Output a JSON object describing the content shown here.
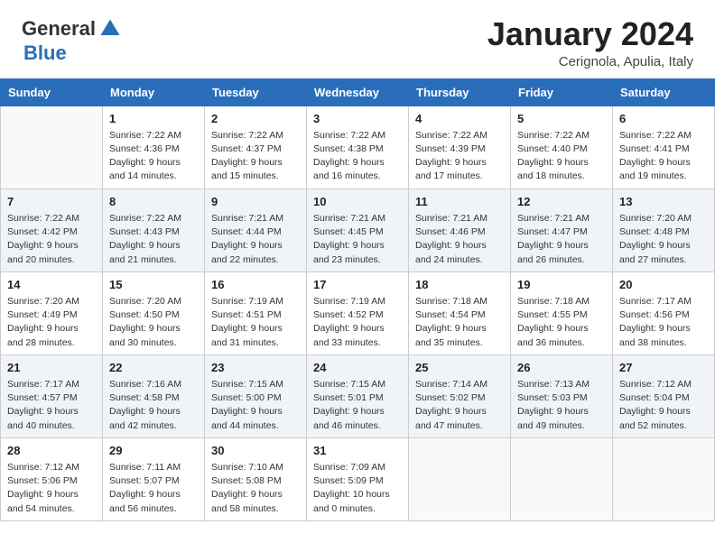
{
  "header": {
    "logo_general": "General",
    "logo_blue": "Blue",
    "month": "January 2024",
    "location": "Cerignola, Apulia, Italy"
  },
  "columns": [
    "Sunday",
    "Monday",
    "Tuesday",
    "Wednesday",
    "Thursday",
    "Friday",
    "Saturday"
  ],
  "weeks": [
    [
      {
        "day": "",
        "info": ""
      },
      {
        "day": "1",
        "info": "Sunrise: 7:22 AM\nSunset: 4:36 PM\nDaylight: 9 hours\nand 14 minutes."
      },
      {
        "day": "2",
        "info": "Sunrise: 7:22 AM\nSunset: 4:37 PM\nDaylight: 9 hours\nand 15 minutes."
      },
      {
        "day": "3",
        "info": "Sunrise: 7:22 AM\nSunset: 4:38 PM\nDaylight: 9 hours\nand 16 minutes."
      },
      {
        "day": "4",
        "info": "Sunrise: 7:22 AM\nSunset: 4:39 PM\nDaylight: 9 hours\nand 17 minutes."
      },
      {
        "day": "5",
        "info": "Sunrise: 7:22 AM\nSunset: 4:40 PM\nDaylight: 9 hours\nand 18 minutes."
      },
      {
        "day": "6",
        "info": "Sunrise: 7:22 AM\nSunset: 4:41 PM\nDaylight: 9 hours\nand 19 minutes."
      }
    ],
    [
      {
        "day": "7",
        "info": "Sunrise: 7:22 AM\nSunset: 4:42 PM\nDaylight: 9 hours\nand 20 minutes."
      },
      {
        "day": "8",
        "info": "Sunrise: 7:22 AM\nSunset: 4:43 PM\nDaylight: 9 hours\nand 21 minutes."
      },
      {
        "day": "9",
        "info": "Sunrise: 7:21 AM\nSunset: 4:44 PM\nDaylight: 9 hours\nand 22 minutes."
      },
      {
        "day": "10",
        "info": "Sunrise: 7:21 AM\nSunset: 4:45 PM\nDaylight: 9 hours\nand 23 minutes."
      },
      {
        "day": "11",
        "info": "Sunrise: 7:21 AM\nSunset: 4:46 PM\nDaylight: 9 hours\nand 24 minutes."
      },
      {
        "day": "12",
        "info": "Sunrise: 7:21 AM\nSunset: 4:47 PM\nDaylight: 9 hours\nand 26 minutes."
      },
      {
        "day": "13",
        "info": "Sunrise: 7:20 AM\nSunset: 4:48 PM\nDaylight: 9 hours\nand 27 minutes."
      }
    ],
    [
      {
        "day": "14",
        "info": "Sunrise: 7:20 AM\nSunset: 4:49 PM\nDaylight: 9 hours\nand 28 minutes."
      },
      {
        "day": "15",
        "info": "Sunrise: 7:20 AM\nSunset: 4:50 PM\nDaylight: 9 hours\nand 30 minutes."
      },
      {
        "day": "16",
        "info": "Sunrise: 7:19 AM\nSunset: 4:51 PM\nDaylight: 9 hours\nand 31 minutes."
      },
      {
        "day": "17",
        "info": "Sunrise: 7:19 AM\nSunset: 4:52 PM\nDaylight: 9 hours\nand 33 minutes."
      },
      {
        "day": "18",
        "info": "Sunrise: 7:18 AM\nSunset: 4:54 PM\nDaylight: 9 hours\nand 35 minutes."
      },
      {
        "day": "19",
        "info": "Sunrise: 7:18 AM\nSunset: 4:55 PM\nDaylight: 9 hours\nand 36 minutes."
      },
      {
        "day": "20",
        "info": "Sunrise: 7:17 AM\nSunset: 4:56 PM\nDaylight: 9 hours\nand 38 minutes."
      }
    ],
    [
      {
        "day": "21",
        "info": "Sunrise: 7:17 AM\nSunset: 4:57 PM\nDaylight: 9 hours\nand 40 minutes."
      },
      {
        "day": "22",
        "info": "Sunrise: 7:16 AM\nSunset: 4:58 PM\nDaylight: 9 hours\nand 42 minutes."
      },
      {
        "day": "23",
        "info": "Sunrise: 7:15 AM\nSunset: 5:00 PM\nDaylight: 9 hours\nand 44 minutes."
      },
      {
        "day": "24",
        "info": "Sunrise: 7:15 AM\nSunset: 5:01 PM\nDaylight: 9 hours\nand 46 minutes."
      },
      {
        "day": "25",
        "info": "Sunrise: 7:14 AM\nSunset: 5:02 PM\nDaylight: 9 hours\nand 47 minutes."
      },
      {
        "day": "26",
        "info": "Sunrise: 7:13 AM\nSunset: 5:03 PM\nDaylight: 9 hours\nand 49 minutes."
      },
      {
        "day": "27",
        "info": "Sunrise: 7:12 AM\nSunset: 5:04 PM\nDaylight: 9 hours\nand 52 minutes."
      }
    ],
    [
      {
        "day": "28",
        "info": "Sunrise: 7:12 AM\nSunset: 5:06 PM\nDaylight: 9 hours\nand 54 minutes."
      },
      {
        "day": "29",
        "info": "Sunrise: 7:11 AM\nSunset: 5:07 PM\nDaylight: 9 hours\nand 56 minutes."
      },
      {
        "day": "30",
        "info": "Sunrise: 7:10 AM\nSunset: 5:08 PM\nDaylight: 9 hours\nand 58 minutes."
      },
      {
        "day": "31",
        "info": "Sunrise: 7:09 AM\nSunset: 5:09 PM\nDaylight: 10 hours\nand 0 minutes."
      },
      {
        "day": "",
        "info": ""
      },
      {
        "day": "",
        "info": ""
      },
      {
        "day": "",
        "info": ""
      }
    ]
  ]
}
